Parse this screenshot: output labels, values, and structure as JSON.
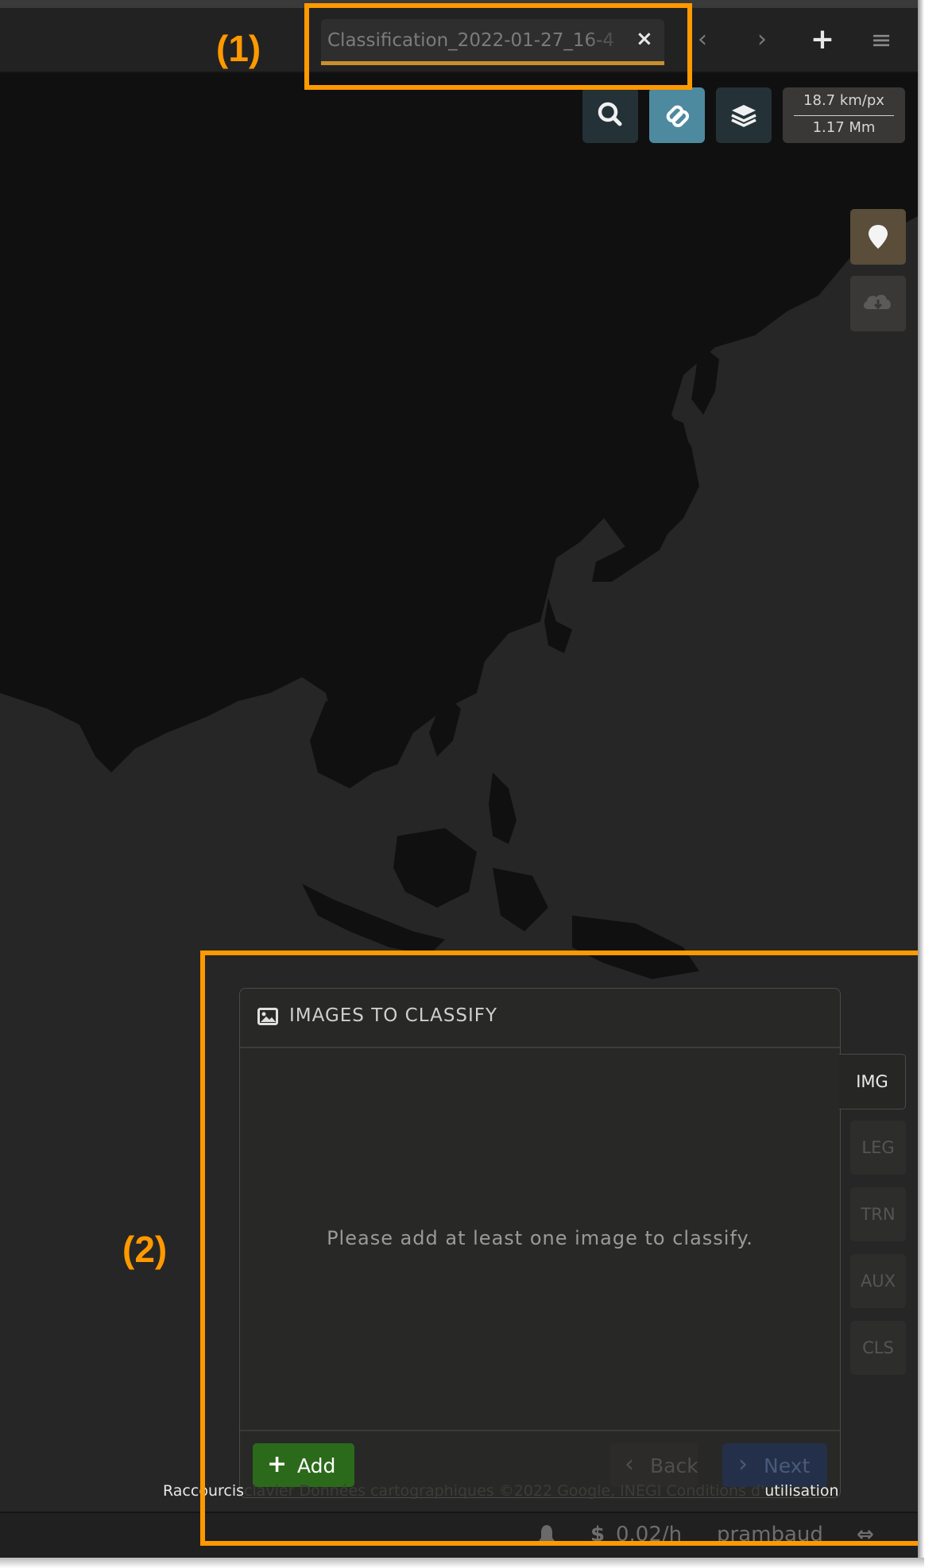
{
  "tab": {
    "title": "Classification_2022-01-27_16-4",
    "close": "×"
  },
  "nav": {
    "prev": "‹",
    "next": "›",
    "new_tab": "+",
    "menu": "≡"
  },
  "toolbar": {
    "icons": [
      "search-icon",
      "link-icon",
      "layers-icon"
    ],
    "scale_top": "18.7 km/px",
    "scale_bottom": "1.17 Mm"
  },
  "side_buttons": [
    "map-marker-icon",
    "cloud-download-icon"
  ],
  "annotations": {
    "label1": "(1)",
    "label2": "(2)"
  },
  "panel": {
    "title": "IMAGES TO CLASSIFY",
    "empty_message": "Please add at least one image to classify.",
    "add_label": "Add",
    "back_label": "Back",
    "next_label": "Next"
  },
  "side_tabs": [
    {
      "label": "IMG",
      "active": true
    },
    {
      "label": "LEG",
      "active": false
    },
    {
      "label": "TRN",
      "active": false
    },
    {
      "label": "AUX",
      "active": false
    },
    {
      "label": "CLS",
      "active": false
    }
  ],
  "attribution": {
    "shortcuts": "Raccourcis",
    "middle": "clavier   Données cartographiques ©2022 Google, INEGI   Conditions d'",
    "terms": "utilisation"
  },
  "status": {
    "cost": "0.02/h",
    "user": "prambaud"
  },
  "colors": {
    "accent": "#ff9900",
    "tab_underline": "#c8902c",
    "add_button": "#2b6a1a",
    "link_tool": "#4d8aa0"
  }
}
